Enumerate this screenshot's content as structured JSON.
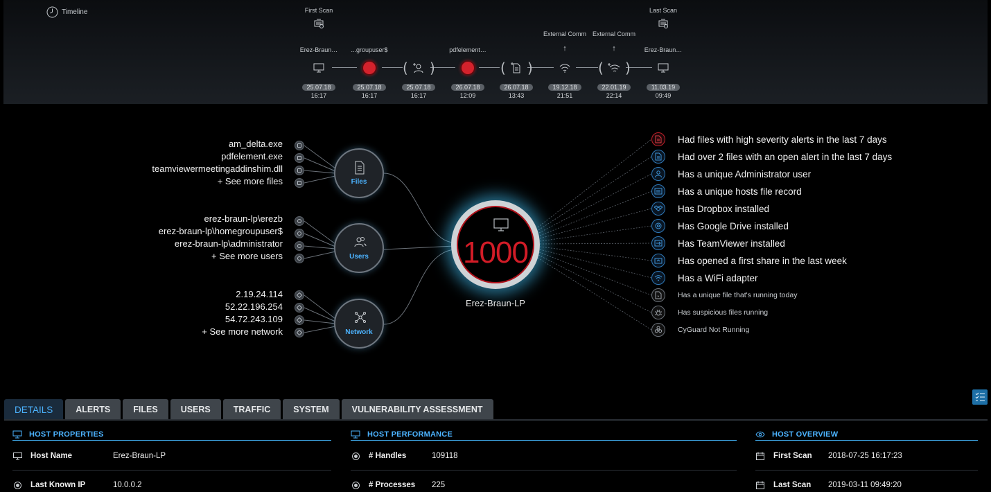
{
  "timeline": {
    "title": "Timeline",
    "events": [
      {
        "scan_label": "First Scan",
        "label": "Erez-Braun…",
        "icon": "monitor-icon",
        "date": "25.07.18",
        "time": "16:17"
      },
      {
        "label": "...groupuser$",
        "icon": "alert-red-icon",
        "date": "25.07.18",
        "time": "16:17"
      },
      {
        "label": "",
        "icon": "add-user-icon",
        "date": "25.07.18",
        "time": "16:17"
      },
      {
        "label": "pdfelement…",
        "icon": "alert-red-icon",
        "date": "26.07.18",
        "time": "12:09"
      },
      {
        "label": "",
        "icon": "add-file-icon",
        "date": "26.07.18",
        "time": "13:43"
      },
      {
        "ext_label": "External Comm",
        "icon": "wifi-icon",
        "date": "19.12.18",
        "time": "21:51"
      },
      {
        "ext_label": "External Comm",
        "icon": "add-wifi-icon",
        "date": "22.01.19",
        "time": "22:14"
      },
      {
        "scan_label": "Last Scan",
        "label": "Erez-Braun…",
        "icon": "monitor-icon",
        "date": "11.03.19",
        "time": "09:49"
      }
    ]
  },
  "graph": {
    "files": {
      "hub": "Files",
      "items": [
        "am_delta.exe",
        "pdfelement.exe",
        "teamviewermeetingaddinshim.dll",
        "+ See more files"
      ]
    },
    "users": {
      "hub": "Users",
      "items": [
        "erez-braun-lp\\erezb",
        "erez-braun-lp\\homegroupuser$",
        "erez-braun-lp\\administrator",
        "+ See more users"
      ]
    },
    "network": {
      "hub": "Network",
      "items": [
        "2.19.24.114",
        "52.22.196.254",
        "54.72.243.109",
        "+ See more network"
      ]
    },
    "center": {
      "score": "1000",
      "host": "Erez-Braun-LP",
      "accent": "#d21c27"
    }
  },
  "insights": [
    {
      "text": "Had files with high severity alerts in the last 7 days",
      "icon": "file-alert-icon",
      "tone": "red"
    },
    {
      "text": "Had over 2 files with an open alert in the last 7 days",
      "icon": "file-icon",
      "tone": "blue"
    },
    {
      "text": "Has a unique Administrator user",
      "icon": "admin-user-icon",
      "tone": "blue"
    },
    {
      "text": "Has a unique hosts file record",
      "icon": "hosts-file-icon",
      "tone": "blue"
    },
    {
      "text": "Has Dropbox installed",
      "icon": "dropbox-icon",
      "tone": "blue"
    },
    {
      "text": "Has Google Drive installed",
      "icon": "google-drive-icon",
      "tone": "blue"
    },
    {
      "text": "Has TeamViewer installed",
      "icon": "teamviewer-icon",
      "tone": "blue"
    },
    {
      "text": "Has opened a first share in the last week",
      "icon": "share-icon",
      "tone": "blue"
    },
    {
      "text": "Has a WiFi adapter",
      "icon": "wifi-adapter-icon",
      "tone": "blue"
    },
    {
      "text": "Has a unique file that's running today",
      "icon": "running-file-icon",
      "tone": "gray",
      "small": true
    },
    {
      "text": "Has suspicious files running",
      "icon": "bug-icon",
      "tone": "gray",
      "small": true
    },
    {
      "text": "CyGuard Not Running",
      "icon": "biohazard-icon",
      "tone": "gray",
      "small": true
    }
  ],
  "tabs": [
    "DETAILS",
    "ALERTS",
    "FILES",
    "USERS",
    "TRAFFIC",
    "SYSTEM",
    "VULNERABILITY ASSESSMENT"
  ],
  "active_tab": "DETAILS",
  "panels": {
    "host_properties": {
      "title": "HOST PROPERTIES",
      "rows": [
        {
          "key": "Host Name",
          "value": "Erez-Braun-LP",
          "icon": "monitor-icon"
        },
        {
          "key": "Last Known IP",
          "value": "10.0.0.2",
          "icon": "radio-icon"
        }
      ]
    },
    "host_performance": {
      "title": "HOST PERFORMANCE",
      "rows": [
        {
          "key": "# Handles",
          "value": "109118",
          "icon": "radio-icon"
        },
        {
          "key": "# Processes",
          "value": "225",
          "icon": "radio-icon"
        }
      ]
    },
    "host_overview": {
      "title": "HOST OVERVIEW",
      "rows": [
        {
          "key": "First Scan",
          "value": "2018-07-25 16:17:23",
          "icon": "calendar-icon"
        },
        {
          "key": "Last Scan",
          "value": "2019-03-11 09:49:20",
          "icon": "calendar-icon"
        }
      ]
    }
  },
  "colors": {
    "accent_blue": "#4cb3ff",
    "alert_red": "#d21c27",
    "glow": "#46c8ff"
  }
}
